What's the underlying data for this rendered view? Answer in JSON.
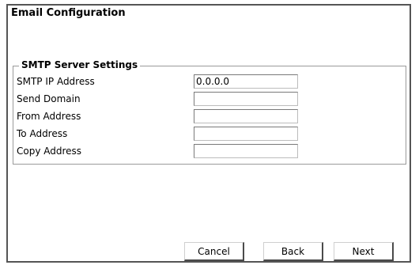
{
  "page": {
    "title": "Email Configuration"
  },
  "smtp": {
    "legend": "SMTP Server Settings",
    "fields": [
      {
        "label": "SMTP IP Address",
        "value": "0.0.0.0"
      },
      {
        "label": "Send Domain",
        "value": ""
      },
      {
        "label": "From Address",
        "value": ""
      },
      {
        "label": "To Address",
        "value": ""
      },
      {
        "label": "Copy Address",
        "value": ""
      }
    ]
  },
  "buttons": {
    "cancel": "Cancel",
    "back": "Back",
    "next": "Next"
  }
}
